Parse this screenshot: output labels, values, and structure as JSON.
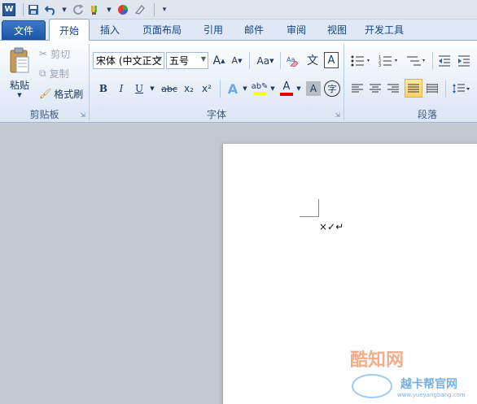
{
  "qat": {
    "word_icon": "W",
    "save_icon": "save-icon",
    "undo_icon": "undo-icon",
    "redo_icon": "redo-icon"
  },
  "tabs": [
    {
      "label": "文件"
    },
    {
      "label": "开始"
    },
    {
      "label": "插入"
    },
    {
      "label": "页面布局"
    },
    {
      "label": "引用"
    },
    {
      "label": "邮件"
    },
    {
      "label": "审阅"
    },
    {
      "label": "视图"
    },
    {
      "label": "开发工具"
    }
  ],
  "clipboard": {
    "paste": "粘贴",
    "cut": "剪切",
    "copy": "复制",
    "format_painter": "格式刷",
    "group_label": "剪贴板"
  },
  "font": {
    "font_name": "宋体 (中文正文",
    "font_size": "五号",
    "bold": "B",
    "italic": "I",
    "underline": "U",
    "strike": "abc",
    "subscript": "x₂",
    "superscript": "x²",
    "change_case": "Aa",
    "grow": "A",
    "shrink": "A",
    "group_label": "字体",
    "char_border": "A",
    "phonetic": "文",
    "enclose": "字"
  },
  "paragraph": {
    "group_label": "段落"
  },
  "document": {
    "text": "×✓↵"
  },
  "watermark": {
    "site_name": "酷知网",
    "logo_text": "越卡帮官网",
    "url": "www.yueyangbang.com"
  },
  "colors": {
    "file_tab": "#2b62b3",
    "highlight": "#ffff00",
    "font_color": "#ff0000"
  }
}
